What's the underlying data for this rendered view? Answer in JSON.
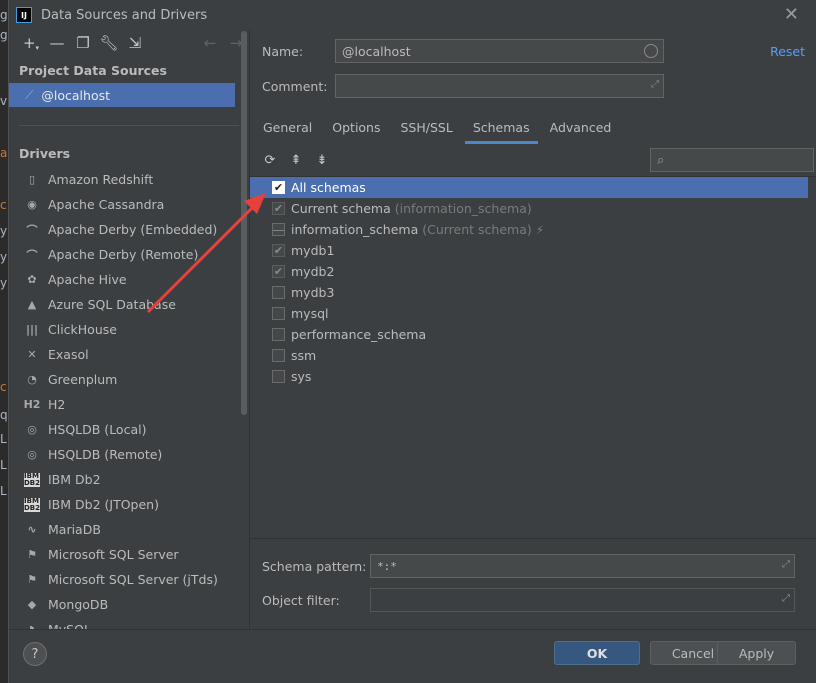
{
  "window": {
    "title": "Data Sources and Drivers",
    "app_icon": "IJ"
  },
  "left_toolbar": {
    "buttons": [
      "add-icon",
      "remove-icon",
      "duplicate-icon",
      "wrench-icon",
      "import-icon"
    ],
    "nav": [
      "back-arrow-icon",
      "forward-arrow-icon"
    ]
  },
  "project_sources": {
    "header": "Project Data Sources",
    "items": [
      {
        "label": "@localhost"
      }
    ]
  },
  "drivers": {
    "header": "Drivers",
    "items": [
      {
        "label": "Amazon Redshift",
        "icon": "▯"
      },
      {
        "label": "Apache Cassandra",
        "icon": "◉"
      },
      {
        "label": "Apache Derby (Embedded)",
        "icon": "⌒"
      },
      {
        "label": "Apache Derby (Remote)",
        "icon": "⌒"
      },
      {
        "label": "Apache Hive",
        "icon": "✿"
      },
      {
        "label": "Azure SQL Database",
        "icon": "▲"
      },
      {
        "label": "ClickHouse",
        "icon": "|||"
      },
      {
        "label": "Exasol",
        "icon": "✕"
      },
      {
        "label": "Greenplum",
        "icon": "◔"
      },
      {
        "label": "H2",
        "icon": "H2"
      },
      {
        "label": "HSQLDB (Local)",
        "icon": "◎"
      },
      {
        "label": "HSQLDB (Remote)",
        "icon": "◎"
      },
      {
        "label": "IBM Db2",
        "icon": "IBM DB2"
      },
      {
        "label": "IBM Db2 (JTOpen)",
        "icon": "IBM DB2"
      },
      {
        "label": "MariaDB",
        "icon": "∿"
      },
      {
        "label": "Microsoft SQL Server",
        "icon": "⚑"
      },
      {
        "label": "Microsoft SQL Server (jTds)",
        "icon": "⚑"
      },
      {
        "label": "MongoDB",
        "icon": "◆"
      },
      {
        "label": "MySQL",
        "icon": "◗"
      }
    ]
  },
  "form": {
    "name_label": "Name:",
    "name_value": "@localhost",
    "comment_label": "Comment:",
    "comment_value": "",
    "reset_label": "Reset"
  },
  "tabs": [
    {
      "label": "General",
      "active": false
    },
    {
      "label": "Options",
      "active": false
    },
    {
      "label": "SSH/SSL",
      "active": false
    },
    {
      "label": "Schemas",
      "active": true
    },
    {
      "label": "Advanced",
      "active": false
    }
  ],
  "schema_toolbar": [
    "refresh-icon",
    "expand-all-icon",
    "collapse-all-icon"
  ],
  "schemas": [
    {
      "name": "All schemas",
      "state": "checked",
      "hint": "",
      "selected": true
    },
    {
      "name": "Current schema",
      "state": "dim-checked",
      "hint": "(information_schema)",
      "selected": false
    },
    {
      "name": "information_schema",
      "state": "indeterminate",
      "hint": "(Current schema)",
      "bolt": true,
      "selected": false
    },
    {
      "name": "mydb1",
      "state": "dim-checked",
      "hint": "",
      "selected": false
    },
    {
      "name": "mydb2",
      "state": "dim-checked",
      "hint": "",
      "selected": false
    },
    {
      "name": "mydb3",
      "state": "unchecked",
      "hint": "",
      "selected": false
    },
    {
      "name": "mysql",
      "state": "unchecked",
      "hint": "",
      "selected": false
    },
    {
      "name": "performance_schema",
      "state": "unchecked",
      "hint": "",
      "selected": false
    },
    {
      "name": "ssm",
      "state": "unchecked",
      "hint": "",
      "selected": false
    },
    {
      "name": "sys",
      "state": "unchecked",
      "hint": "",
      "selected": false
    }
  ],
  "bottom": {
    "schema_pattern_label": "Schema pattern:",
    "schema_pattern_value": "*:*",
    "object_filter_label": "Object filter:",
    "object_filter_value": ""
  },
  "footer": {
    "help": "?",
    "ok": "OK",
    "cancel": "Cancel",
    "apply": "Apply"
  },
  "colors": {
    "selection": "#4b6eaf",
    "annotation_arrow": "#e8403a",
    "ok_button": "#365880"
  }
}
